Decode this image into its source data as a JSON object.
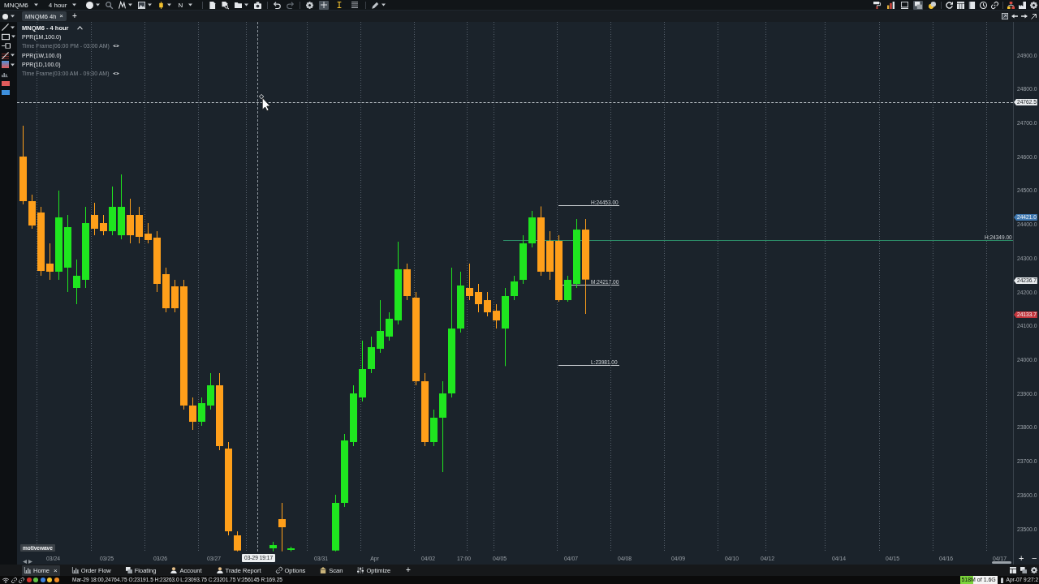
{
  "toolbar": {
    "symbol": "MNQM6",
    "bar_size": "4 hour",
    "letter_menu": "N",
    "cursor_modes": [
      {
        "selected": true
      },
      {
        "selected": false
      },
      {
        "selected": false
      }
    ],
    "panel_toggles": [
      {
        "selected": false
      },
      {
        "selected": false
      },
      {
        "selected": false
      },
      {
        "selected": true
      },
      {
        "selected": false
      }
    ]
  },
  "chart_tabs": {
    "tabs": [
      {
        "label": "MNQM6 4h",
        "close": "×",
        "selected": true
      }
    ],
    "add": "+"
  },
  "drawing_tools": {
    "swatches": [
      {
        "color": "#e25b5b"
      },
      {
        "color": "#3d8fdc"
      }
    ]
  },
  "chart": {
    "legend": {
      "title": "MNQM6 - 4 hour",
      "items": [
        {
          "kind": "study",
          "label": "PPR(1M,100.0)"
        },
        {
          "kind": "time_frame",
          "label": "Time Frame(06:00 PM - 03:00 AM)"
        },
        {
          "kind": "study",
          "label": "PPR(1W,100.0)"
        },
        {
          "kind": "study",
          "label": "PPR(1D,100.0)"
        },
        {
          "kind": "time_frame",
          "label": "Time Frame(03:00 AM - 09:30 AM)"
        }
      ]
    },
    "chart_data": {
      "type": "candlestick",
      "categories": [
        null,
        null,
        null,
        "03/24",
        null,
        null,
        null,
        null,
        null,
        "03/25",
        null,
        null,
        null,
        null,
        null,
        "03/26",
        null,
        null,
        null,
        null,
        null,
        "03/27",
        null,
        null,
        null,
        null,
        null,
        null,
        null,
        null,
        null,
        null,
        null,
        "03/31",
        null,
        null,
        null,
        null,
        null,
        "Apr",
        null,
        null,
        null,
        null,
        null,
        "04/02",
        null,
        null,
        null,
        "17:00",
        null,
        null,
        null,
        "04/05",
        null,
        null,
        null,
        null,
        null,
        null,
        null,
        "04/07",
        null,
        null,
        null,
        null,
        null,
        "04/08",
        null,
        null,
        null,
        null,
        null,
        "04/09",
        null,
        null,
        null,
        null,
        null,
        "04/10",
        null,
        null,
        null,
        "04/12",
        null,
        null,
        null,
        null,
        null,
        null,
        null,
        "04/14",
        null,
        null,
        null,
        null,
        null,
        "04/15",
        null,
        null,
        null,
        null,
        null,
        "04/16",
        null,
        null,
        null,
        null,
        null,
        "04/17",
        null
      ],
      "ohlc": [
        [
          24600.25,
          24691.5,
          24459,
          24468.5
        ],
        [
          24468.5,
          24487.75,
          24387,
          24396.5
        ],
        [
          24435,
          24451.75,
          24248,
          24262.25
        ],
        [
          24284,
          24343.75,
          24236,
          24260
        ],
        [
          24260,
          24499.75,
          24236,
          24420.5
        ],
        [
          24272,
          24427.75,
          24200,
          24391.75
        ],
        [
          24212,
          24296,
          24164,
          24248
        ],
        [
          24236,
          24451.75,
          24212,
          24403.75
        ],
        [
          24427.75,
          24463.75,
          24367.75,
          24387
        ],
        [
          24403.75,
          24427.75,
          24367.75,
          24379.75
        ],
        [
          24379.75,
          24511.75,
          24367.75,
          24451.75
        ],
        [
          24367.75,
          24547.5,
          24355.75,
          24451.75
        ],
        [
          24427.75,
          24475.75,
          24343.75,
          24367.75
        ],
        [
          24427.75,
          24451.75,
          24343.75,
          24363
        ],
        [
          24372.5,
          24403.75,
          24343.75,
          24353.5
        ],
        [
          24360.75,
          24379.75,
          24200,
          24224
        ],
        [
          24252.75,
          24272,
          24140,
          24152
        ],
        [
          24216.75,
          24236,
          24140,
          24152
        ],
        [
          24216.75,
          24236,
          23852.5,
          23864.5
        ],
        [
          23864.5,
          23888.25,
          23792.5,
          23816.5
        ],
        [
          23816.5,
          23888.25,
          23804.5,
          23871.5
        ],
        [
          23864.5,
          23960.25,
          23852.5,
          23924.25
        ],
        [
          23924.25,
          23960.25,
          23732.5,
          23744.5
        ],
        [
          23737.25,
          23756.5,
          23480.75,
          23492.75
        ],
        [
          23480.75,
          23492.75,
          23433.5,
          23436
        ],
        null,
        null,
        null,
        [
          23442.5,
          23461.75,
          23433.5,
          23452
        ],
        [
          23528.75,
          23576.75,
          23433.5,
          23504.75
        ],
        [
          23437.75,
          23447.25,
          23433.5,
          23442.5
        ],
        null,
        null,
        null,
        null,
        [
          23436,
          23600.75,
          23433.5,
          23576.75
        ],
        [
          23576.75,
          23780.5,
          23564.75,
          23761.25
        ],
        [
          23756.5,
          23924.25,
          23744.5,
          23900.25
        ],
        [
          23888.25,
          24056.25,
          23876.5,
          23972.25
        ],
        [
          23972.25,
          24068.25,
          23960.25,
          24037
        ],
        [
          24032.25,
          24176,
          24020.25,
          24085
        ],
        [
          24068.25,
          24140,
          24056.25,
          24121
        ],
        [
          24116,
          24348.75,
          24104,
          24267.25
        ],
        [
          24267.25,
          24284,
          24176,
          24188
        ],
        [
          24183.25,
          24200,
          23924.25,
          23936.25
        ],
        [
          23936.25,
          23960.25,
          23744.5,
          23756.5
        ],
        [
          23756.5,
          23852.5,
          23744.5,
          23828.5
        ],
        [
          23828.5,
          23936.25,
          23667.75,
          23900.25
        ],
        [
          23900.25,
          24272,
          23888.25,
          24092
        ],
        [
          24092,
          24260,
          24080.25,
          24219.25
        ],
        [
          24212,
          24284,
          24176,
          24188
        ],
        [
          24200,
          24224,
          24140,
          24164
        ],
        [
          24176,
          24200,
          24128,
          24140
        ],
        [
          24144.75,
          24164,
          24092,
          24116
        ],
        [
          24092,
          24212,
          23981,
          24188
        ],
        [
          24188,
          24248,
          24176,
          24231.25
        ],
        [
          24236,
          24367.75,
          24224,
          24343.75
        ],
        [
          24343.75,
          24439.75,
          24331.75,
          24420.5
        ],
        [
          24420.5,
          24453,
          24248,
          24260
        ],
        [
          24351,
          24379.75,
          24236,
          24260
        ],
        [
          24351,
          24367.75,
          24171.25,
          24176
        ],
        [
          24176,
          24248,
          24171.25,
          24236
        ],
        [
          24224,
          24415.75,
          24212,
          24384.5
        ],
        [
          24384.5,
          24415.75,
          24135.25,
          24236.75
        ],
        null,
        null,
        null,
        null,
        null,
        null,
        null,
        null,
        null,
        null,
        null,
        null,
        null,
        null,
        null,
        null,
        null,
        null,
        null,
        null,
        null,
        null,
        null,
        null,
        null,
        null,
        null,
        null,
        null,
        null,
        null,
        null,
        null,
        null,
        null,
        null,
        null,
        null,
        null,
        null,
        null,
        null,
        null,
        null,
        null,
        null,
        null
      ],
      "ylim": [
        23432.9,
        24998.3
      ],
      "yticks": [
        {
          "value": 24900,
          "label": "24900.0"
        },
        {
          "value": 24800,
          "label": "24800.0"
        },
        {
          "value": 24700,
          "label": "24700.0"
        },
        {
          "value": 24600,
          "label": "24600.0"
        },
        {
          "value": 24500,
          "label": "24500.0"
        },
        {
          "value": 24400,
          "label": "24400.0"
        },
        {
          "value": 24300,
          "label": "24300.0"
        },
        {
          "value": 24200,
          "label": "24200.0"
        },
        {
          "value": 24100,
          "label": "24100.0"
        },
        {
          "value": 24000,
          "label": "24000.0"
        },
        {
          "value": 23900,
          "label": "23900.0"
        },
        {
          "value": 23800,
          "label": "23800.0"
        },
        {
          "value": 23700,
          "label": "23700.0"
        },
        {
          "value": 23600,
          "label": "23600.0"
        },
        {
          "value": 23500,
          "label": "23500.0"
        }
      ]
    },
    "price_tags": [
      {
        "text": "24762.5",
        "color": "#e9ecef"
      },
      {
        "text": "24421.0",
        "color": "#3f78b0"
      },
      {
        "text": "24236.7",
        "color": "#e9ecef"
      },
      {
        "text": "24133.7",
        "color": "#c4363d"
      }
    ],
    "levels": [
      "H:24453.00",
      "M:24217.00",
      "L:23981.00",
      "H:24349.00"
    ],
    "crosshair_time": "03-29 19:17",
    "brand": "motivewave",
    "zoom_buttons": [
      "+",
      "−"
    ]
  },
  "bottom_tabs": {
    "tabs": [
      {
        "label": "Home",
        "close": "×",
        "selected": true
      },
      {
        "label": "Order Flow",
        "selected": false
      },
      {
        "label": "Floating",
        "selected": false
      },
      {
        "label": "Account",
        "selected": false
      },
      {
        "label": "Trade Report",
        "selected": false
      },
      {
        "label": "Options",
        "selected": false
      },
      {
        "label": "Scan",
        "selected": false
      },
      {
        "label": "Optimize",
        "selected": false
      }
    ],
    "add": "+"
  },
  "status_bar": {
    "indicators": [
      {
        "color": "#d3312b"
      },
      {
        "color": "#62c244"
      },
      {
        "color": "#3f82dc"
      },
      {
        "color": "#f4c430"
      },
      {
        "color": "#f08a24"
      }
    ],
    "quote": "Mar-29 18:00,24764.75 O:23191.5 H:23263.0 L:23093.75 C:23201.75 V:256145 R:169.25",
    "memory": {
      "text": "518M of 1.6G",
      "level": 0.35
    },
    "clock": "Apr-07 9:27:2"
  }
}
